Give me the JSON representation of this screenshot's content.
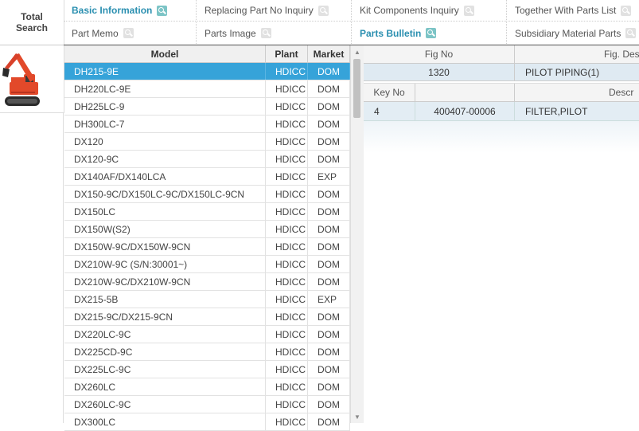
{
  "total_search": "Total Search",
  "tabs": [
    {
      "label": "Basic Information",
      "active": true
    },
    {
      "label": "Replacing Part No Inquiry",
      "active": false
    },
    {
      "label": "Kit Components Inquiry",
      "active": false
    },
    {
      "label": "Together With Parts List",
      "active": false
    },
    {
      "label": "Part Memo",
      "active": false
    },
    {
      "label": "Parts Image",
      "active": false
    },
    {
      "label": "Parts Bulletin",
      "active": true
    },
    {
      "label": "Subsidiary Material Parts",
      "active": false
    }
  ],
  "model_table": {
    "headers": {
      "model": "Model",
      "plant": "Plant",
      "market": "Market"
    },
    "rows": [
      {
        "model": "DH215-9E",
        "plant": "HDICC",
        "market": "DOM"
      },
      {
        "model": "DH220LC-9E",
        "plant": "HDICC",
        "market": "DOM"
      },
      {
        "model": "DH225LC-9",
        "plant": "HDICC",
        "market": "DOM"
      },
      {
        "model": "DH300LC-7",
        "plant": "HDICC",
        "market": "DOM"
      },
      {
        "model": "DX120",
        "plant": "HDICC",
        "market": "DOM"
      },
      {
        "model": "DX120-9C",
        "plant": "HDICC",
        "market": "DOM"
      },
      {
        "model": "DX140AF/DX140LCA",
        "plant": "HDICC",
        "market": "EXP"
      },
      {
        "model": "DX150-9C/DX150LC-9C/DX150LC-9CN",
        "plant": "HDICC",
        "market": "DOM"
      },
      {
        "model": "DX150LC",
        "plant": "HDICC",
        "market": "DOM"
      },
      {
        "model": "DX150W(S2)",
        "plant": "HDICC",
        "market": "DOM"
      },
      {
        "model": "DX150W-9C/DX150W-9CN",
        "plant": "HDICC",
        "market": "DOM"
      },
      {
        "model": "DX210W-9C (S/N:30001~)",
        "plant": "HDICC",
        "market": "DOM"
      },
      {
        "model": "DX210W-9C/DX210W-9CN",
        "plant": "HDICC",
        "market": "DOM"
      },
      {
        "model": "DX215-5B",
        "plant": "HDICC",
        "market": "EXP"
      },
      {
        "model": "DX215-9C/DX215-9CN",
        "plant": "HDICC",
        "market": "DOM"
      },
      {
        "model": "DX220LC-9C",
        "plant": "HDICC",
        "market": "DOM"
      },
      {
        "model": "DX225CD-9C",
        "plant": "HDICC",
        "market": "DOM"
      },
      {
        "model": "DX225LC-9C",
        "plant": "HDICC",
        "market": "DOM"
      },
      {
        "model": "DX260LC",
        "plant": "HDICC",
        "market": "DOM"
      },
      {
        "model": "DX260LC-9C",
        "plant": "HDICC",
        "market": "DOM"
      },
      {
        "model": "DX300LC",
        "plant": "HDICC",
        "market": "DOM"
      }
    ]
  },
  "fig_table": {
    "headers": {
      "fig_no": "Fig No",
      "fig_desc": "Fig. Des"
    },
    "row": {
      "fig_no": "1320",
      "fig_desc": "PILOT PIPING(1)"
    }
  },
  "part_table": {
    "headers": {
      "key_no": "Key No",
      "part_no": "",
      "desc": "Descr"
    },
    "row": {
      "key_no": "4",
      "part_no": "400407-00006",
      "desc": "FILTER,PILOT"
    }
  },
  "colors": {
    "accent": "#2a8fb0",
    "selected_row": "#36a3d9",
    "excavator": "#e2492a"
  }
}
